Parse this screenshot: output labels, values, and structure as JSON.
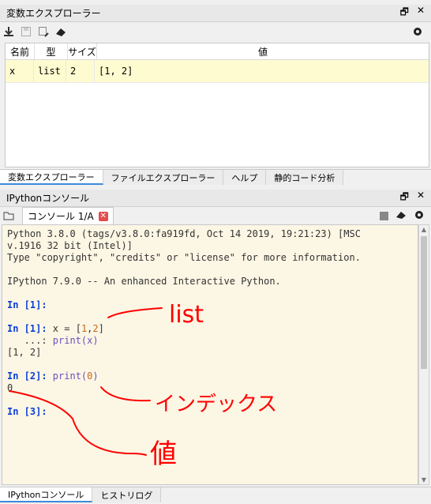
{
  "variable_explorer": {
    "title": "変数エクスプローラー",
    "columns": [
      "名前",
      "型",
      "サイズ",
      "値"
    ],
    "rows": [
      {
        "name": "x",
        "type": "list",
        "size": "2",
        "value": "[1, 2]"
      }
    ]
  },
  "upper_tabs": [
    "変数エクスプローラー",
    "ファイルエクスプローラー",
    "ヘルプ",
    "静的コード分析"
  ],
  "console_pane": {
    "title": "IPythonコンソール",
    "tab_label": "コンソール 1/A"
  },
  "console": {
    "header_line1": "Python 3.8.0 (tags/v3.8.0:fa919fd, Oct 14 2019, 19:21:23) [MSC",
    "header_line2": "v.1916 32 bit (Intel)]",
    "header_line3": "Type \"copyright\", \"credits\" or \"license\" for more information.",
    "header_line4": "IPython 7.9.0 -- An enhanced Interactive Python.",
    "prompt1": "In [1]:",
    "prompt1b": "In [1]:",
    "code1a": " x = [1,2]",
    "cont_prompt": "   ...:",
    "code1b": " print(x)",
    "out1": "[1, 2]",
    "prompt2": "In [2]:",
    "code2": " print(0)",
    "out2": "0",
    "prompt3": "In [3]:"
  },
  "lower_tabs": [
    "IPythonコンソール",
    "ヒストリログ"
  ],
  "annotations": {
    "note1": "list",
    "note2": "インデックス",
    "note3": "値",
    "color": "#ff0000"
  }
}
